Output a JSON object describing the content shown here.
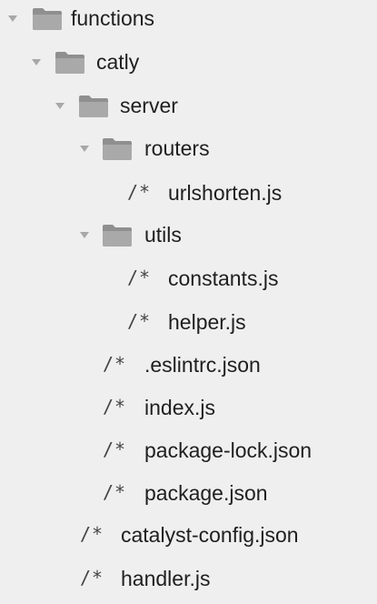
{
  "tree": {
    "items": [
      {
        "name": "functions",
        "type": "folder",
        "expanded": true,
        "icon": "folder-icon"
      },
      {
        "name": "catly",
        "type": "folder",
        "expanded": true,
        "icon": "folder-icon"
      },
      {
        "name": "server",
        "type": "folder",
        "expanded": true,
        "icon": "folder-icon"
      },
      {
        "name": "routers",
        "type": "folder",
        "expanded": true,
        "icon": "folder-icon"
      },
      {
        "name": "urlshorten.js",
        "type": "file",
        "icon": "code-file-icon",
        "glyph": "/*"
      },
      {
        "name": "utils",
        "type": "folder",
        "expanded": true,
        "icon": "folder-icon"
      },
      {
        "name": "constants.js",
        "type": "file",
        "icon": "code-file-icon",
        "glyph": "/*"
      },
      {
        "name": "helper.js",
        "type": "file",
        "icon": "code-file-icon",
        "glyph": "/*"
      },
      {
        "name": ".eslintrc.json",
        "type": "file",
        "icon": "code-file-icon",
        "glyph": "/*"
      },
      {
        "name": "index.js",
        "type": "file",
        "icon": "code-file-icon",
        "glyph": "/*"
      },
      {
        "name": "package-lock.json",
        "type": "file",
        "icon": "code-file-icon",
        "glyph": "/*"
      },
      {
        "name": "package.json",
        "type": "file",
        "icon": "code-file-icon",
        "glyph": "/*"
      },
      {
        "name": "catalyst-config.json",
        "type": "file",
        "icon": "code-file-icon",
        "glyph": "/*"
      },
      {
        "name": "handler.js",
        "type": "file",
        "icon": "code-file-icon",
        "glyph": "/*"
      }
    ]
  },
  "colors": {
    "background": "#efefef",
    "chevron": "#a8a8a8",
    "folder": "#9a9a9a",
    "text": "#1f1f1f"
  }
}
